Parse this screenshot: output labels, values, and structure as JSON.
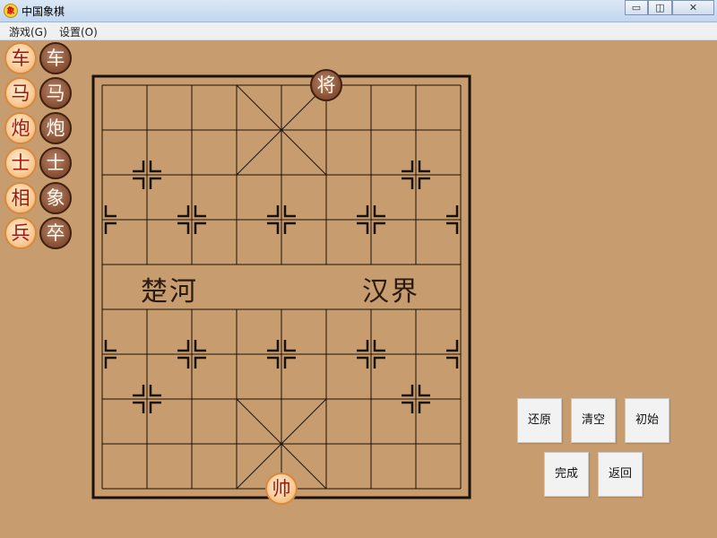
{
  "window": {
    "title": "中国象棋",
    "app_icon_glyph": "象",
    "controls": {
      "minimize": "▭",
      "maximize": "◫",
      "close": "✕"
    }
  },
  "menu": {
    "items": [
      "游戏(G)",
      "设置(O)"
    ]
  },
  "palette": {
    "rows": [
      {
        "red": "车",
        "black": "车"
      },
      {
        "red": "马",
        "black": "马"
      },
      {
        "red": "炮",
        "black": "炮"
      },
      {
        "red": "士",
        "black": "士"
      },
      {
        "red": "相",
        "black": "象"
      },
      {
        "red": "兵",
        "black": "卒"
      }
    ]
  },
  "board": {
    "river_left": "楚河",
    "river_right": "汉界",
    "pieces": [
      {
        "label": "将",
        "side": "black",
        "file": 5,
        "rank": 0
      },
      {
        "label": "帅",
        "side": "red",
        "file": 4,
        "rank": 9
      }
    ]
  },
  "controls": {
    "restore": "还原",
    "clear": "清空",
    "initial": "初始",
    "done": "完成",
    "back": "返回"
  },
  "colors": {
    "background": "#c79c6e",
    "red_piece_text": "#a11a10",
    "black_piece_fill": "#8c5539"
  }
}
